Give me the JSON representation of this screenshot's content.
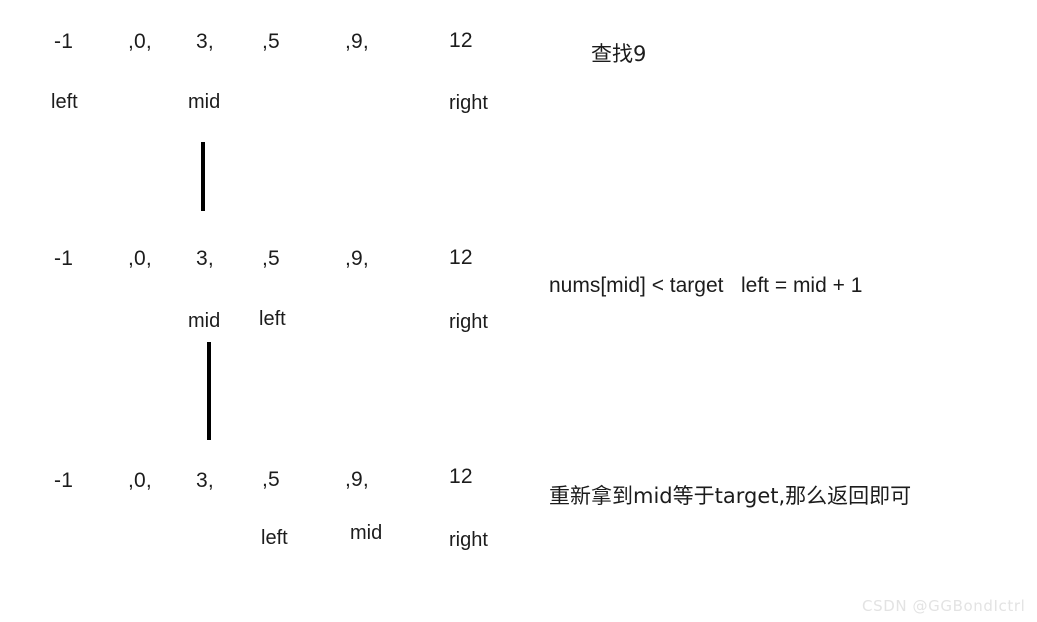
{
  "diagram": {
    "title_note": "查找9",
    "watermark": "CSDN @GGBondIctrl",
    "array_tokens": [
      "-1",
      ",0,",
      "3,",
      ",5",
      ",9,",
      "12"
    ],
    "rows": [
      {
        "id": "step-1",
        "values": [
          "-1",
          ",0,",
          "3,",
          ",5",
          ",9,",
          "12"
        ],
        "pointers": [
          {
            "label": "left",
            "index": 0
          },
          {
            "label": "mid",
            "index": 2
          },
          {
            "label": "right",
            "index": 5
          }
        ],
        "note": "查找9"
      },
      {
        "id": "step-2",
        "values": [
          "-1",
          ",0,",
          "3,",
          ",5",
          ",9,",
          "12"
        ],
        "pointers": [
          {
            "label": "mid",
            "index": 2
          },
          {
            "label": "left",
            "index": 3
          },
          {
            "label": "right",
            "index": 5
          }
        ],
        "note": "nums[mid] < target   left = mid + 1"
      },
      {
        "id": "step-3",
        "values": [
          "-1",
          ",0,",
          "3,",
          ",5",
          ",9,",
          "12"
        ],
        "pointers": [
          {
            "label": "left",
            "index": 3
          },
          {
            "label": "mid",
            "index": 4
          },
          {
            "label": "right",
            "index": 5
          }
        ],
        "note": "重新拿到mid等于target,那么返回即可"
      }
    ],
    "connectors": [
      {
        "id": "connector-1-2",
        "from_row": "step-1",
        "to_row": "step-2"
      },
      {
        "id": "connector-2-3",
        "from_row": "step-2",
        "to_row": "step-3"
      }
    ],
    "colors": {
      "ink": "#1c1c1c",
      "connector": "#000000",
      "watermark": "#e3e3e3",
      "background": "#ffffff"
    }
  }
}
